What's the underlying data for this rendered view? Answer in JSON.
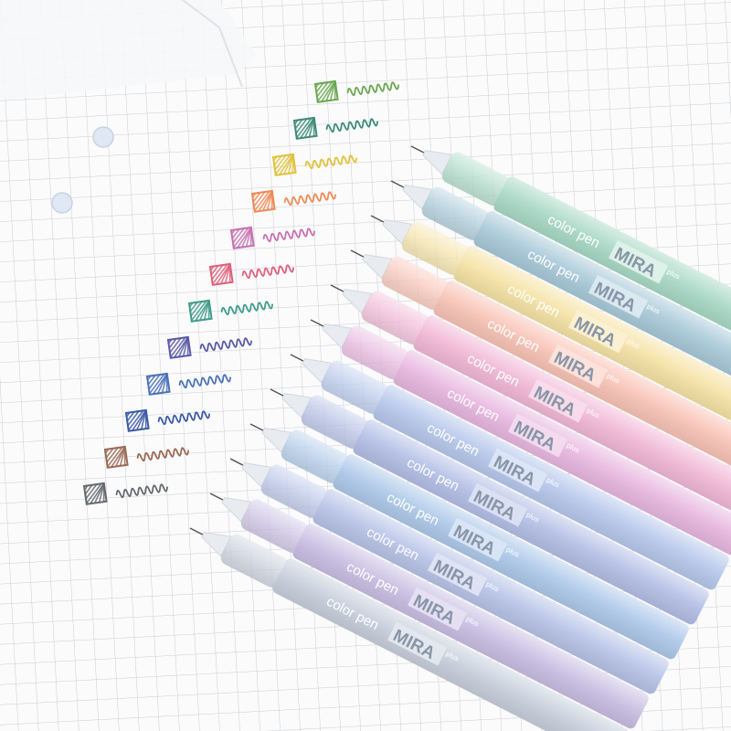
{
  "pen_brand": {
    "prefix": "color pen",
    "name": "MIRA",
    "suffix": "plus"
  },
  "colors": {
    "paper": "#fbfbfc",
    "grid": "#c9ccd1",
    "background": "#eef0f3"
  },
  "swatches": [
    {
      "color": "#6aa84f"
    },
    {
      "color": "#3d8b76"
    },
    {
      "color": "#e0c23a"
    },
    {
      "color": "#f08a55"
    },
    {
      "color": "#c86fb0"
    },
    {
      "color": "#e0607a"
    },
    {
      "color": "#3f9c8a"
    },
    {
      "color": "#5a5aa8"
    },
    {
      "color": "#4a72b8"
    },
    {
      "color": "#3d5aa5"
    },
    {
      "color": "#9a6a55"
    },
    {
      "color": "#666a70"
    }
  ],
  "pens": [
    {
      "barrel": "#a9d9c6",
      "label_color": "#ffffff",
      "label_bg": "#e0f2ea"
    },
    {
      "barrel": "#a8c9d8",
      "label_color": "#ffffff",
      "label_bg": "#dceaf1"
    },
    {
      "barrel": "#f6e3a6",
      "label_color": "#ffffff",
      "label_bg": "#fbf1d2"
    },
    {
      "barrel": "#f9c3b6",
      "label_color": "#ffffff",
      "label_bg": "#fde3dc"
    },
    {
      "barrel": "#f1b8d6",
      "label_color": "#ffffff",
      "label_bg": "#f8dceb"
    },
    {
      "barrel": "#e8b7e0",
      "label_color": "#ffffff",
      "label_bg": "#f3dbef"
    },
    {
      "barrel": "#b7c8ec",
      "label_color": "#ffffff",
      "label_bg": "#dde6f6"
    },
    {
      "barrel": "#b3bfe6",
      "label_color": "#ffffff",
      "label_bg": "#dce2f3"
    },
    {
      "barrel": "#aec9ea",
      "label_color": "#ffffff",
      "label_bg": "#d9e6f5"
    },
    {
      "barrel": "#b8c4e8",
      "label_color": "#ffffff",
      "label_bg": "#dfe4f4"
    },
    {
      "barrel": "#c9bfe3",
      "label_color": "#ffffff",
      "label_bg": "#e6e0f2"
    },
    {
      "barrel": "#c7cfdc",
      "label_color": "#ffffff",
      "label_bg": "#e4e8ee"
    }
  ]
}
